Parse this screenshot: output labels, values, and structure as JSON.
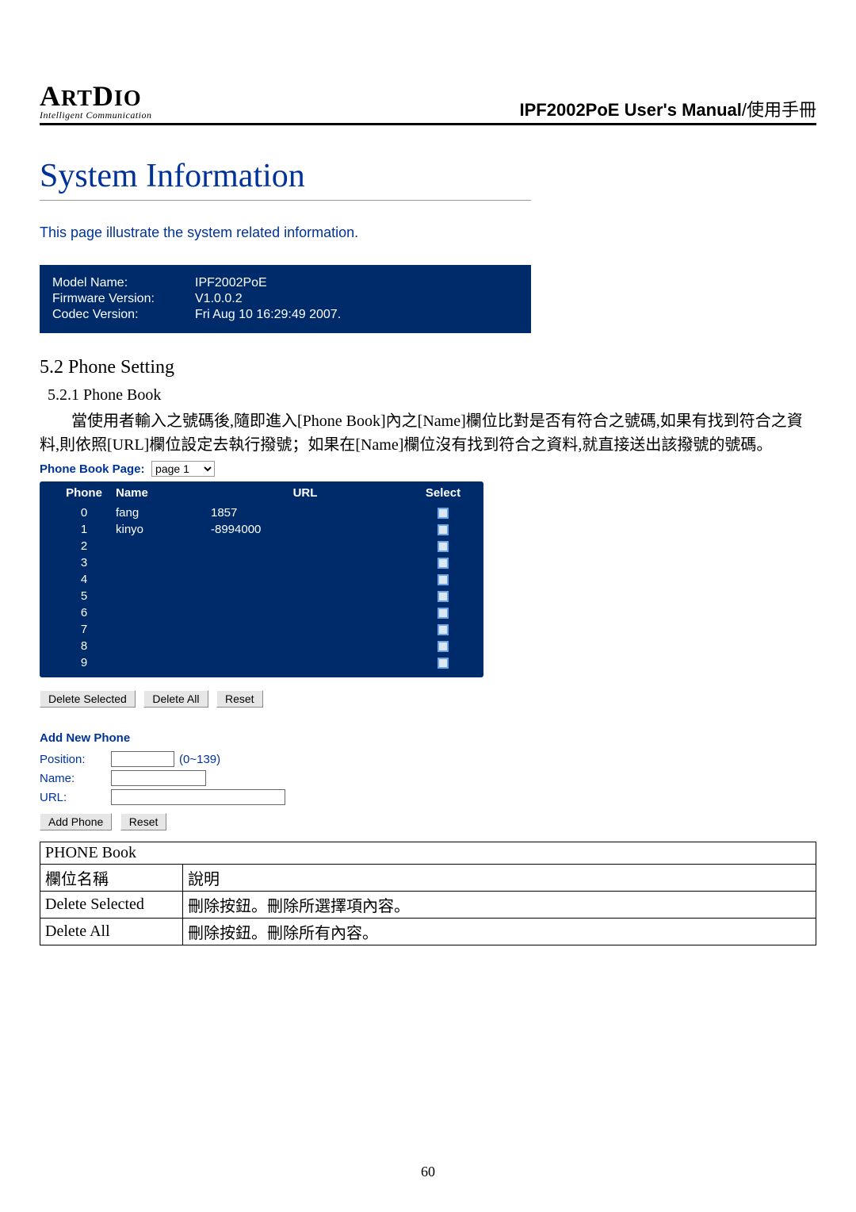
{
  "brand": {
    "name": "ArtDio",
    "tagline": "Intelligent Communication"
  },
  "manual_title_bold": "IPF2002PoE User's Manual",
  "manual_title_suffix": "/使用手冊",
  "sys_info": {
    "heading": "System Information",
    "desc": "This page illustrate the system related information.",
    "rows": [
      {
        "label": "Model Name:",
        "value": "IPF2002PoE"
      },
      {
        "label": "Firmware Version:",
        "value": "V1.0.0.2"
      },
      {
        "label": "Codec Version:",
        "value": "Fri Aug 10 16:29:49 2007."
      }
    ]
  },
  "section_5_2": "5.2 Phone Setting",
  "section_5_2_1": "5.2.1 Phone Book",
  "paragraph": "當使用者輸入之號碼後,隨即進入[Phone Book]內之[Name]欄位比對是否有符合之號碼,如果有找到符合之資料,則依照[URL]欄位設定去執行撥號；如果在[Name]欄位沒有找到符合之資料,就直接送出該撥號的號碼。",
  "pb_page_label": "Phone Book Page:",
  "pb_page_value": "page 1",
  "pb_columns": {
    "phone": "Phone",
    "name": "Name",
    "url": "URL",
    "select": "Select"
  },
  "pb_rows": [
    {
      "phone": "0",
      "name": "fang",
      "url": "1857"
    },
    {
      "phone": "1",
      "name": "kinyo",
      "url": "-8994000"
    },
    {
      "phone": "2",
      "name": "",
      "url": ""
    },
    {
      "phone": "3",
      "name": "",
      "url": ""
    },
    {
      "phone": "4",
      "name": "",
      "url": ""
    },
    {
      "phone": "5",
      "name": "",
      "url": ""
    },
    {
      "phone": "6",
      "name": "",
      "url": ""
    },
    {
      "phone": "7",
      "name": "",
      "url": ""
    },
    {
      "phone": "8",
      "name": "",
      "url": ""
    },
    {
      "phone": "9",
      "name": "",
      "url": ""
    }
  ],
  "buttons": {
    "delete_selected": "Delete Selected",
    "delete_all": "Delete All",
    "reset": "Reset",
    "add_phone": "Add Phone"
  },
  "add_section": {
    "title": "Add New Phone",
    "position_label": "Position:",
    "position_hint": "(0~139)",
    "name_label": "Name:",
    "url_label": "URL:"
  },
  "explain": {
    "title": "PHONE Book",
    "col_name": "欄位名稱",
    "col_desc": "說明",
    "rows": [
      {
        "name": "Delete Selected",
        "desc": "刪除按鈕。刪除所選擇項內容。"
      },
      {
        "name": "Delete All",
        "desc": "刪除按鈕。刪除所有內容。"
      }
    ]
  },
  "page_number": "60"
}
